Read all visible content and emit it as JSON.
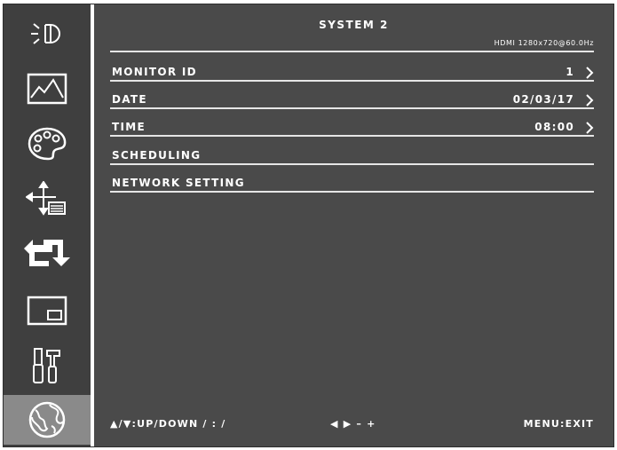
{
  "menu": {
    "title": "SYSTEM 2",
    "signal_info": "HDMI 1280x720@60.0Hz",
    "active_tab": "system-globe",
    "sidebar": [
      {
        "icon": "brightness-icon"
      },
      {
        "icon": "picture-icon"
      },
      {
        "icon": "color-palette-icon"
      },
      {
        "icon": "position-icon"
      },
      {
        "icon": "input-switch-icon"
      },
      {
        "icon": "pip-icon"
      },
      {
        "icon": "tools-icon"
      },
      {
        "icon": "globe-icon"
      }
    ],
    "items": [
      {
        "label": "MONITOR ID",
        "value": "1",
        "has_arrow": true
      },
      {
        "label": "DATE",
        "value": "02/03/17",
        "has_arrow": true
      },
      {
        "label": "TIME",
        "value": "08:00",
        "has_arrow": true
      },
      {
        "label": "SCHEDULING",
        "value": "",
        "has_arrow": false
      },
      {
        "label": "NETWORK SETTING",
        "value": "",
        "has_arrow": false
      }
    ],
    "footer": {
      "nav_hint": "▲/▼:UP/DOWN   / : /",
      "adjust_hint": "◀ ▶ – +",
      "exit_hint": "MENU:EXIT"
    }
  }
}
